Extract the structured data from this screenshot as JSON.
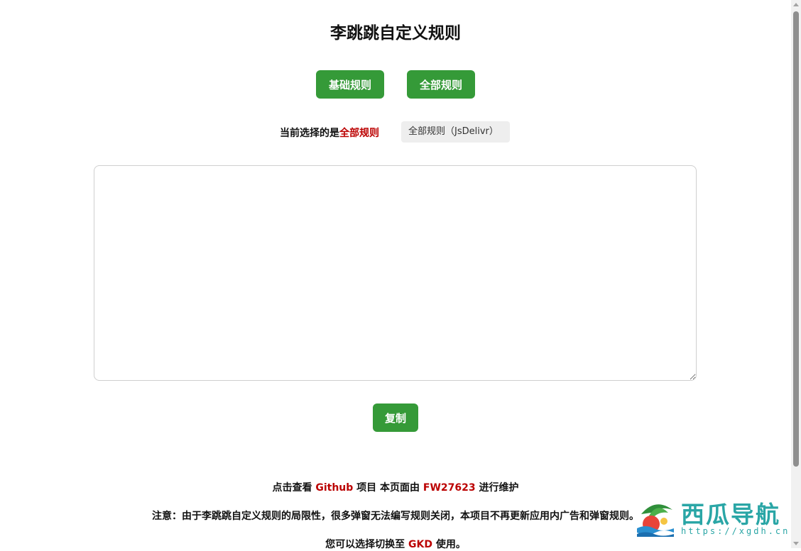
{
  "page": {
    "title": "李跳跳自定义规则"
  },
  "buttons": {
    "basic": "基础规则",
    "all": "全部规则",
    "copy": "复制"
  },
  "selection": {
    "prefix": "当前选择的是",
    "current": "全部规则",
    "source_option": "全部规则（JsDelivr）"
  },
  "editor": {
    "value": ""
  },
  "footer": {
    "line1": {
      "a": "点击查看 ",
      "github": "Github",
      "b": " 项目 本页面由 ",
      "maintainer": "FW27623",
      "c": " 进行维护"
    },
    "line2": "注意：由于李跳跳自定义规则的局限性，很多弹窗无法编写规则关闭，本项目不再更新应用内广告和弹窗规则。",
    "line3": {
      "a": "您可以选择切换至 ",
      "gkd": "GKD",
      "b": " 使用。"
    }
  },
  "watermark": {
    "name": "西瓜导航",
    "url": "https://xgdh.cn"
  },
  "colors": {
    "accent_green": "#359a38",
    "highlight_red": "#bb0000",
    "watermark_teal": "#2aa6a6"
  }
}
